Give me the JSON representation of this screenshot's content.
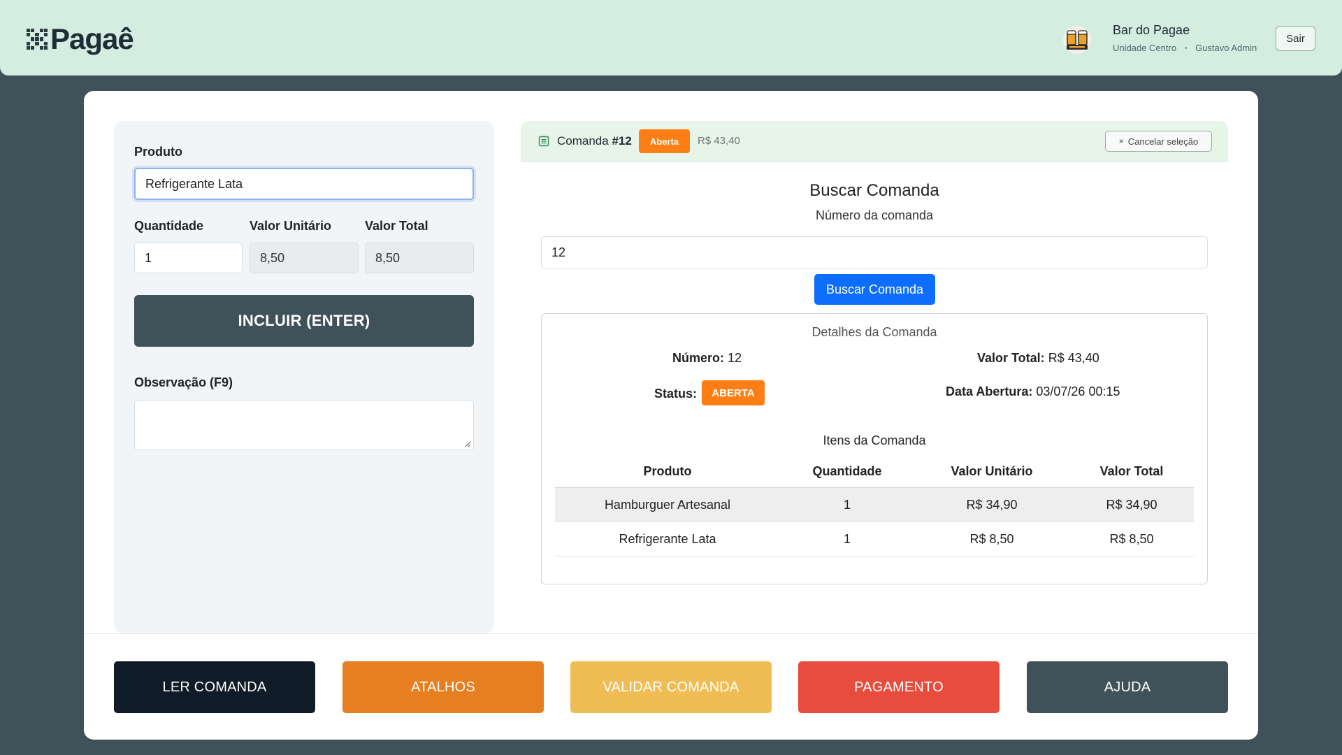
{
  "header": {
    "logo_text": "Pagaê",
    "business_name": "Bar do Pagae",
    "unit": "Unidade Centro",
    "user": "Gustavo Admin",
    "logout_label": "Sair"
  },
  "product_form": {
    "product_label": "Produto",
    "product_value": "Refrigerante Lata",
    "quantity_label": "Quantidade",
    "quantity_value": "1",
    "unit_value_label": "Valor Unitário",
    "unit_value": "8,50",
    "total_value_label": "Valor Total",
    "total_value": "8,50",
    "include_label": "INCLUIR (ENTER)",
    "observation_label": "Observação (F9)",
    "observation_value": ""
  },
  "comanda_header": {
    "title_prefix": "Comanda ",
    "number_label": "#12",
    "status_badge": "Aberta",
    "amount": "R$ 43,40",
    "cancel_label": "Cancelar seleção"
  },
  "search": {
    "title": "Buscar Comanda",
    "number_label": "Número da comanda",
    "number_value": "12",
    "button_label": "Buscar Comanda"
  },
  "details": {
    "title": "Detalhes da Comanda",
    "numero_label": "Número:",
    "numero_value": "12",
    "valor_total_label": "Valor Total:",
    "valor_total_value": "R$ 43,40",
    "status_label": "Status:",
    "status_value": "ABERTA",
    "data_abertura_label": "Data Abertura:",
    "data_abertura_value": "03/07/26 00:15",
    "items_title": "Itens da Comanda",
    "columns": [
      "Produto",
      "Quantidade",
      "Valor Unitário",
      "Valor Total"
    ],
    "rows": [
      [
        "Hamburguer Artesanal",
        "1",
        "R$ 34,90",
        "R$ 34,90"
      ],
      [
        "Refrigerante Lata",
        "1",
        "R$ 8,50",
        "R$ 8,50"
      ]
    ]
  },
  "actions": [
    {
      "label": "LER COMANDA",
      "color": "#0f1b26"
    },
    {
      "label": "ATALHOS",
      "color": "#e67e22"
    },
    {
      "label": "VALIDAR COMANDA",
      "color": "#f0bd55"
    },
    {
      "label": "PAGAMENTO",
      "color": "#e74c3c"
    },
    {
      "label": "AJUDA",
      "color": "#3f5259"
    }
  ],
  "colors": {
    "header_bg": "#d3ede1",
    "page_bg": "#3f5259",
    "primary": "#0d6efd",
    "status_orange": "#fd7e14"
  },
  "icons": {
    "logo": "qr-code-icon",
    "avatar": "bar-logo-icon",
    "comanda": "receipt-icon",
    "cancel": "close-icon"
  }
}
